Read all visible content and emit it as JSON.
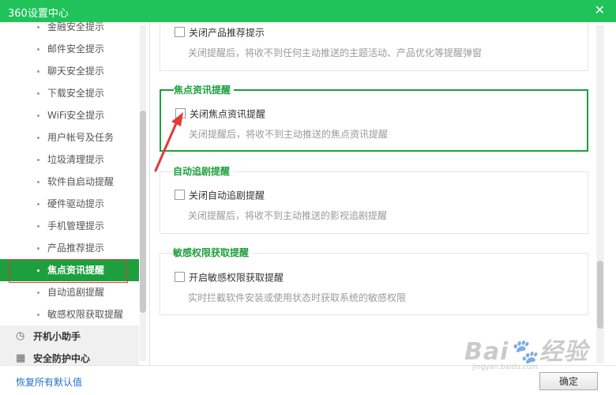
{
  "window": {
    "title": "360设置中心",
    "close_glyph": "✕"
  },
  "sidebar": {
    "items": [
      {
        "label": "金融安全提示"
      },
      {
        "label": "邮件安全提示"
      },
      {
        "label": "聊天安全提示"
      },
      {
        "label": "下载安全提示"
      },
      {
        "label": "WiFi安全提示"
      },
      {
        "label": "用户帐号及任务"
      },
      {
        "label": "垃圾清理提示"
      },
      {
        "label": "软件自启动提醒"
      },
      {
        "label": "硬件驱动提示"
      },
      {
        "label": "手机管理提示"
      },
      {
        "label": "产品推荐提示"
      },
      {
        "label": "焦点资讯提醒",
        "active": true
      },
      {
        "label": "自动追剧提醒"
      },
      {
        "label": "敏感权限获取提醒"
      }
    ],
    "groups": [
      {
        "label": "开机小助手",
        "icon": "clock-icon"
      },
      {
        "label": "安全防护中心",
        "icon": "grid-icon"
      }
    ]
  },
  "sections": {
    "product": {
      "option": "关闭产品推荐提示",
      "desc": "关闭提醒后，将收不到任何主动推送的主题活动、产品优化等提醒弹窗"
    },
    "focus": {
      "legend": "焦点资讯提醒",
      "option": "关闭焦点资讯提醒",
      "desc": "关闭提醒后，将收不到主动推送的焦点资讯提醒"
    },
    "drama": {
      "legend": "自动追剧提醒",
      "option": "关闭自动追剧提醒",
      "desc": "关闭提醒后，将收不到主动推送的影视追剧提醒"
    },
    "permission": {
      "legend": "敏感权限获取提醒",
      "option": "开启敏感权限获取提醒",
      "desc": "实时拦截软件安装或使用状态时获取系统的敏感权限"
    }
  },
  "footer": {
    "reset_label": "恢复所有默认值",
    "confirm_label": "确定"
  },
  "watermark": {
    "text": "Bai🐾经验",
    "url": "jingyan.baidu.com"
  },
  "colors": {
    "brand_green": "#1fc35a",
    "active_green": "#1d9f3e",
    "link_blue": "#1f70c8",
    "annotation_red": "#e03a3a"
  }
}
